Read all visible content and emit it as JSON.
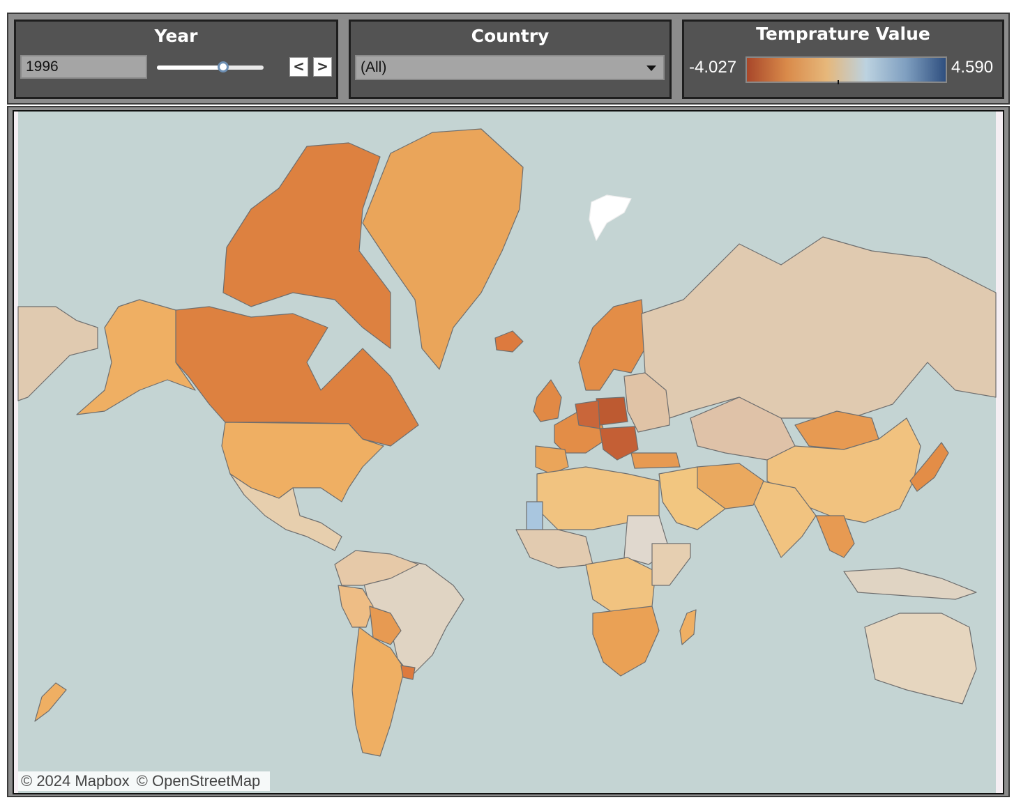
{
  "year_filter": {
    "title": "Year",
    "value": "1996",
    "slider_fraction": 0.62,
    "prev_glyph": "<",
    "next_glyph": ">"
  },
  "country_filter": {
    "title": "Country",
    "selected": "(All)"
  },
  "temperature_legend": {
    "title": "Temprature Value",
    "min": "-4.027",
    "max": "4.590",
    "colors": [
      "#a8472a",
      "#d98a4a",
      "#e6b77a",
      "#bcd2e0",
      "#7f9fc0",
      "#2f4f7f"
    ]
  },
  "map": {
    "ocean_color": "#c4d4d3",
    "attribution": [
      "© 2024 Mapbox",
      "© OpenStreetMap"
    ]
  }
}
